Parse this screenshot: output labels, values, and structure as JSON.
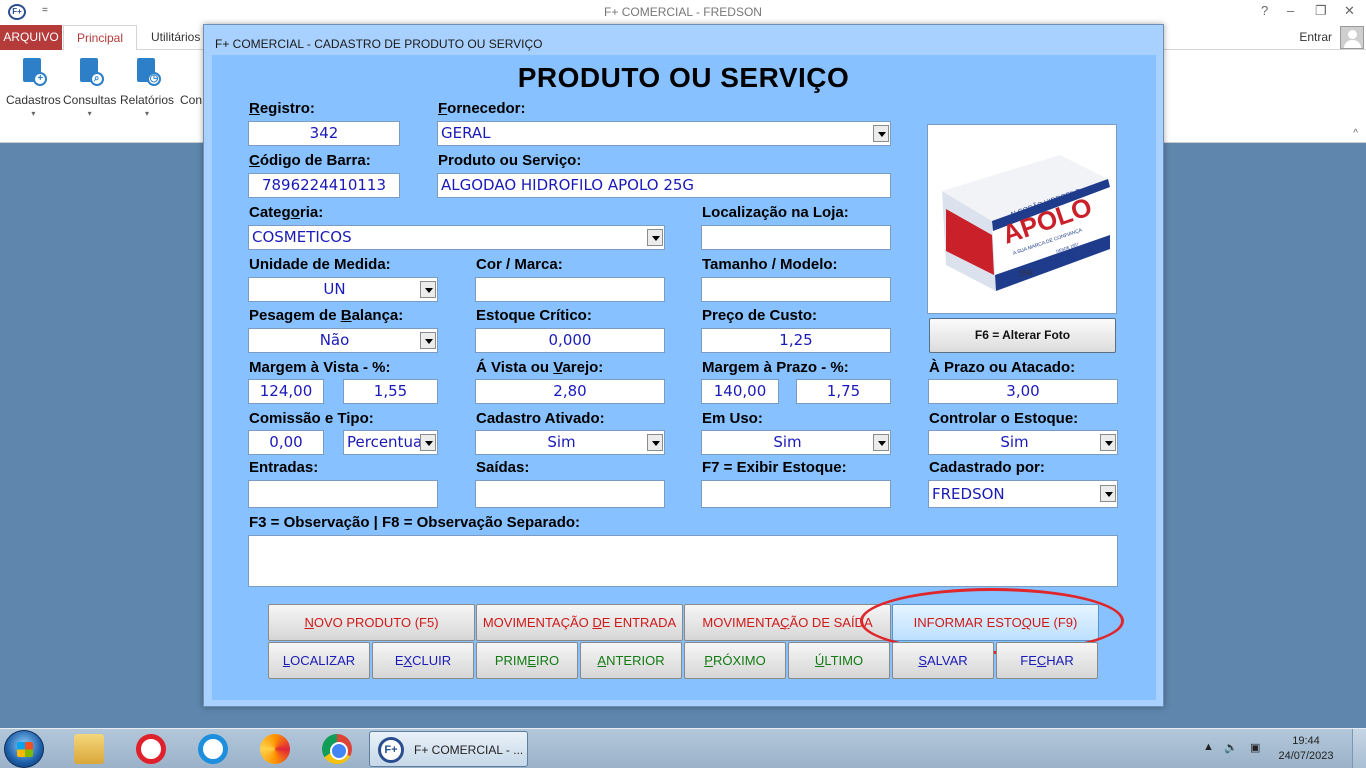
{
  "app": {
    "logo_text": "F+",
    "qa_arrow": "=",
    "title": "F+ COMERCIAL - FREDSON",
    "help": "?",
    "minimize": "–",
    "restore": "❐",
    "close": "✕",
    "tabs": [
      "ARQUIVO",
      "Principal",
      "Utilitários"
    ],
    "signin": "Entrar",
    "ribbon": [
      {
        "label": "Cadastros",
        "icon": "cadastros-icon"
      },
      {
        "label": "Consultas",
        "icon": "consultas-icon"
      },
      {
        "label": "Relatórios",
        "icon": "relatorios-icon"
      },
      {
        "label": "Con",
        "icon": "config-icon"
      }
    ],
    "ribbon_arrow": "▾",
    "ribbon_collapse": "^"
  },
  "dialog": {
    "title": "F+ COMERCIAL - CADASTRO DE PRODUTO OU SERVIÇO",
    "heading": "PRODUTO OU SERVIÇO",
    "labels": {
      "registro": "Registro:",
      "fornecedor": "Fornecedor:",
      "codigo_barra": "Código de Barra:",
      "produto": "Produto ou Serviço:",
      "categoria": "Categoria:",
      "localizacao": "Localização na Loja:",
      "unidade": "Unidade de Medida:",
      "cor": "Cor / Marca:",
      "tamanho": "Tamanho / Modelo:",
      "pesagem": "Pesagem de Balança:",
      "estoque_critico": "Estoque Crítico:",
      "preco_custo": "Preço de Custo:",
      "margem_vista": "Margem à Vista - %:",
      "a_vista": "Á Vista ou Varejo:",
      "margem_prazo": "Margem à Prazo - %:",
      "a_prazo": "À Prazo ou Atacado:",
      "comissao": "Comissão e Tipo:",
      "cadastro_ativado": "Cadastro Ativado:",
      "em_uso": "Em Uso:",
      "controlar_estoque": "Controlar o Estoque:",
      "entradas": "Entradas:",
      "saidas": "Saídas:",
      "exibir_estoque": "F7 = Exibir Estoque:",
      "cadastrado_por": "Cadastrado por:",
      "observacao": "F3 = Observação | F8 = Observação Separado:"
    },
    "values": {
      "registro": "342",
      "fornecedor": "GERAL",
      "codigo_barra": "7896224410113",
      "produto": "ALGODAO HIDROFILO APOLO 25G",
      "categoria": "COSMETICOS",
      "localizacao": "",
      "unidade": "UN",
      "cor": "",
      "tamanho": "",
      "pesagem": "Não",
      "estoque_critico": "0,000",
      "preco_custo": "1,25",
      "margem_vista_pct": "124,00",
      "margem_vista_valor": "1,55",
      "a_vista": "2,80",
      "margem_prazo_pct": "140,00",
      "margem_prazo_valor": "1,75",
      "a_prazo": "3,00",
      "comissao": "0,00",
      "comissao_tipo": "Percentual",
      "cadastro_ativado": "Sim",
      "em_uso": "Sim",
      "controlar_estoque": "Sim",
      "entradas": "",
      "saidas": "",
      "exibir_estoque": "",
      "cadastrado_por": "FREDSON",
      "observacao": ""
    },
    "photo": {
      "brand": "APOLO",
      "top_text": "ALGODÃO HIDROFILO",
      "sub_text": "A SUA MARCA DE CONFIANÇA",
      "weight": "25g",
      "since": "DESDE 1957",
      "button": "F6 = Alterar Foto"
    },
    "buttons_row1": [
      {
        "label": "NOVO PRODUTO (F5)",
        "color": "red"
      },
      {
        "label": "MOVIMENTAÇÃO DE ENTRADA",
        "color": "red"
      },
      {
        "label": "MOVIMENTAÇÃO DE SAÍDA",
        "color": "red"
      },
      {
        "label": "INFORMAR ESTOQUE (F9)",
        "color": "red"
      }
    ],
    "buttons_row2": [
      {
        "label": "LOCALIZAR",
        "color": "blue"
      },
      {
        "label": "EXCLUIR",
        "color": "blue"
      },
      {
        "label": "PRIMEIRO",
        "color": "green"
      },
      {
        "label": "ANTERIOR",
        "color": "green"
      },
      {
        "label": "PRÓXIMO",
        "color": "green"
      },
      {
        "label": "ÚLTIMO",
        "color": "green"
      },
      {
        "label": "SALVAR",
        "color": "blue"
      },
      {
        "label": "FECHAR",
        "color": "blue"
      }
    ],
    "highlight_color": "#e0262b"
  },
  "taskbar": {
    "active_logo": "F+",
    "active_window": "F+ COMERCIAL - ...",
    "tray": {
      "expand": "▲",
      "volume": "🔊",
      "network": "▣"
    },
    "time": "19:44",
    "date": "24/07/2023"
  }
}
